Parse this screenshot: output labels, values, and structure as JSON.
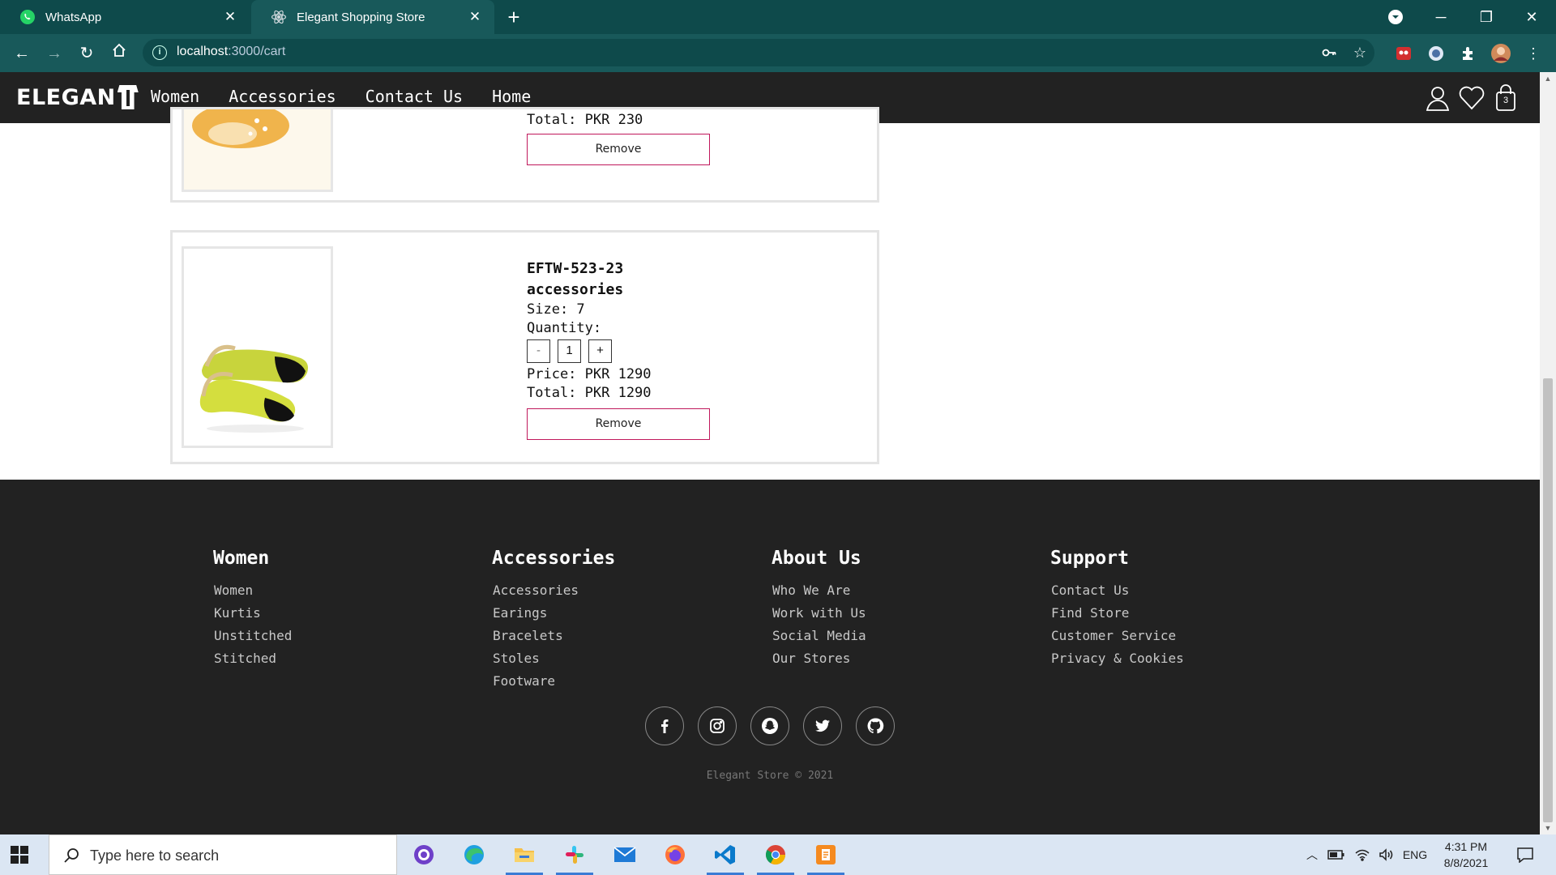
{
  "browser": {
    "tabs": [
      {
        "title": "WhatsApp",
        "icon": "whatsapp-icon"
      },
      {
        "title": "Elegant Shopping Store",
        "icon": "react-icon"
      }
    ],
    "url_host": "localhost",
    "url_path": ":3000/cart"
  },
  "site": {
    "logo_text": "ELEGAN",
    "nav": [
      "Women",
      "Accessories",
      "Contact Us",
      "Home"
    ],
    "cart_count": "3"
  },
  "cart": {
    "items": [
      {
        "total_text": "Total: PKR 230",
        "remove_label": "Remove"
      },
      {
        "code": "EFTW-523-23",
        "category": "accessories",
        "size_text": "Size: 7",
        "quantity_label": "Quantity:",
        "qty_minus": "-",
        "qty_value": "1",
        "qty_plus": "+",
        "price_text": "Price: PKR 1290",
        "total_text": "Total: PKR 1290",
        "remove_label": "Remove"
      }
    ]
  },
  "footer": {
    "columns": [
      {
        "heading": "Women",
        "links": [
          "Women",
          "Kurtis",
          "Unstitched",
          "Stitched"
        ]
      },
      {
        "heading": "Accessories",
        "links": [
          "Accessories",
          "Earings",
          "Bracelets",
          "Stoles",
          "Footware"
        ]
      },
      {
        "heading": "About Us",
        "links": [
          "Who We Are",
          "Work with Us",
          "Social Media",
          "Our Stores"
        ]
      },
      {
        "heading": "Support",
        "links": [
          "Contact Us",
          "Find Store",
          "Customer Service",
          "Privacy & Cookies"
        ]
      }
    ],
    "socials": [
      "facebook-icon",
      "instagram-icon",
      "snapchat-icon",
      "twitter-icon",
      "github-icon"
    ],
    "copyright": "Elegant Store © 2021"
  },
  "taskbar": {
    "search_placeholder": "Type here to search",
    "language": "ENG",
    "time": "4:31 PM",
    "date": "8/8/2021"
  },
  "colors": {
    "chrome_dark": "#0e4a4b",
    "chrome_toolbar": "#18595a",
    "site_header": "#222222",
    "remove_border": "#c0185c",
    "footer_bg": "#222222"
  }
}
